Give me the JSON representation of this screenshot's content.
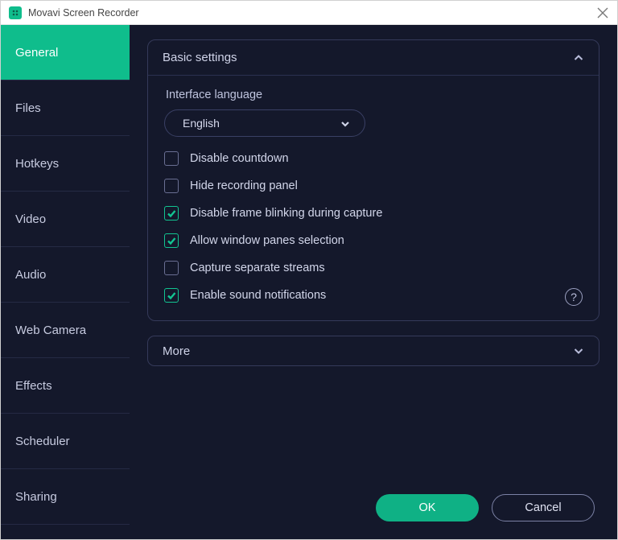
{
  "window": {
    "title": "Movavi Screen Recorder"
  },
  "sidebar": {
    "items": [
      {
        "label": "General",
        "active": true
      },
      {
        "label": "Files"
      },
      {
        "label": "Hotkeys"
      },
      {
        "label": "Video"
      },
      {
        "label": "Audio"
      },
      {
        "label": "Web Camera"
      },
      {
        "label": "Effects"
      },
      {
        "label": "Scheduler"
      },
      {
        "label": "Sharing"
      }
    ]
  },
  "panel": {
    "basic": {
      "title": "Basic settings",
      "language_label": "Interface language",
      "language_value": "English",
      "options": [
        {
          "label": "Disable countdown",
          "checked": false
        },
        {
          "label": "Hide recording panel",
          "checked": false
        },
        {
          "label": "Disable frame blinking during capture",
          "checked": true
        },
        {
          "label": "Allow window panes selection",
          "checked": true
        },
        {
          "label": "Capture separate streams",
          "checked": false
        },
        {
          "label": "Enable sound notifications",
          "checked": true,
          "help": true
        }
      ]
    },
    "more": {
      "title": "More"
    }
  },
  "footer": {
    "ok": "OK",
    "cancel": "Cancel"
  },
  "help_glyph": "?"
}
